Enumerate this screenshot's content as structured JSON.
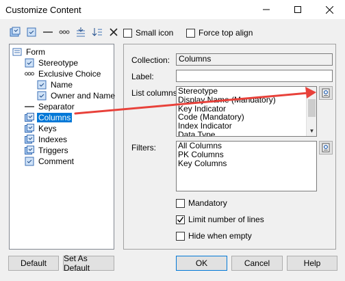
{
  "window": {
    "title": "Customize Content",
    "minimize_glyph": "—",
    "maximize_glyph": "☐",
    "close_glyph": "✕"
  },
  "toolbar": {
    "icons": [
      "add-collection-icon",
      "add-item-icon",
      "separator-icon",
      "exclusive-choice-icon",
      "move-down-icon",
      "sort-icon",
      "delete-icon"
    ],
    "small_icon_label": "Small icon",
    "force_top_align_label": "Force top align",
    "small_icon_checked": false,
    "force_top_align_checked": false
  },
  "tree": {
    "items": [
      {
        "label": "Form",
        "icon": "form-icon",
        "selected": false
      },
      {
        "label": "Stereotype",
        "icon": "attribute-icon",
        "selected": false
      },
      {
        "label": "Exclusive Choice",
        "icon": "exclusive-choice-icon",
        "selected": false
      },
      {
        "label": "Name",
        "icon": "attribute-icon",
        "selected": false
      },
      {
        "label": "Owner and Name",
        "icon": "attribute-icon",
        "selected": false
      },
      {
        "label": "Separator",
        "icon": "separator-icon",
        "selected": false
      },
      {
        "label": "Columns",
        "icon": "collection-icon",
        "selected": true
      },
      {
        "label": "Keys",
        "icon": "collection-icon",
        "selected": false
      },
      {
        "label": "Indexes",
        "icon": "collection-icon",
        "selected": false
      },
      {
        "label": "Triggers",
        "icon": "collection-icon",
        "selected": false
      },
      {
        "label": "Comment",
        "icon": "attribute-icon",
        "selected": false
      }
    ]
  },
  "form": {
    "collection_label": "Collection:",
    "collection_value": "Columns",
    "label_label": "Label:",
    "label_value": "",
    "list_columns_label": "List columns:",
    "list_columns": [
      "Stereotype",
      "Display Name (Mandatory)",
      "Key Indicator",
      "Code (Mandatory)",
      "Index Indicator",
      "Data Type"
    ],
    "filters_label": "Filters:",
    "filters": [
      "All Columns",
      "PK Columns",
      "Key Columns"
    ],
    "mandatory_label": "Mandatory",
    "mandatory_checked": false,
    "limit_lines_label": "Limit number of lines",
    "limit_lines_checked": true,
    "hide_empty_label": "Hide when empty",
    "hide_empty_checked": false
  },
  "buttons": {
    "default": "Default",
    "set_as_default": "Set As Default",
    "ok": "OK",
    "cancel": "Cancel",
    "help": "Help"
  },
  "annotation": {
    "arrow_color": "#e8413a"
  },
  "colors": {
    "selection": "#0078d7",
    "window_bg": "#f0f0f0"
  }
}
